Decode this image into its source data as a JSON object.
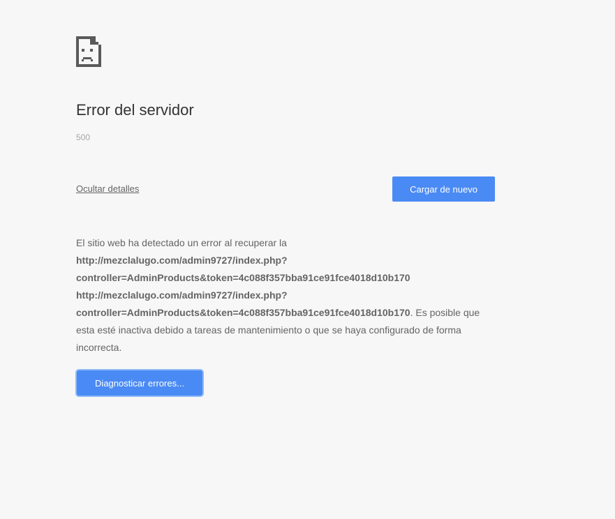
{
  "icon": "sad-page-icon",
  "title": "Error del servidor",
  "error_code": "500",
  "hide_details_label": "Ocultar detalles",
  "reload_label": "Cargar de nuevo",
  "details": {
    "intro": "El sitio web ha detectado un error al recuperar la ",
    "url1": "http://mezclalugo.com/admin9727/index.php?controller=AdminProducts&token=4c088f357bba91ce91fce4018d10b170",
    "url2": "http://mezclalugo.com/admin9727/index.php?controller=AdminProducts&token=4c088f357bba91ce91fce4018d10b170",
    "outro": ". Es posible que esta esté inactiva debido a tareas de mantenimiento o que se haya configurado de forma incorrecta."
  },
  "diagnose_label": "Diagnosticar errores...",
  "colors": {
    "background": "#f7f7f7",
    "button": "#4a8af4",
    "text": "#646464",
    "title": "#333333"
  }
}
